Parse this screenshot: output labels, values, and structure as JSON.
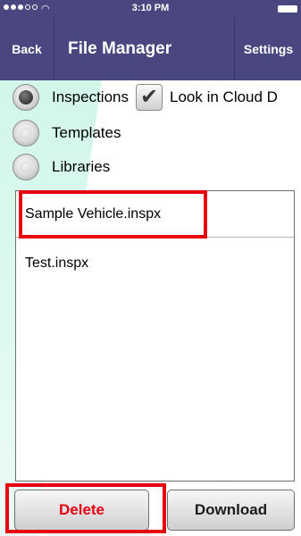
{
  "status_bar": {
    "time": "3:10 PM",
    "signal_icon": "signal-dots-icon",
    "wifi_icon": "wifi-icon",
    "battery_icon": "battery-icon"
  },
  "nav": {
    "back_label": "Back",
    "title": "File Manager",
    "settings_label": "Settings"
  },
  "options": {
    "types": [
      {
        "label": "Inspections",
        "selected": true
      },
      {
        "label": "Templates",
        "selected": false
      },
      {
        "label": "Libraries",
        "selected": false
      }
    ],
    "cloud_checkbox": {
      "label": "Look in Cloud D",
      "checked": true
    }
  },
  "files": [
    {
      "name": "Sample Vehicle.inspx"
    },
    {
      "name": "Test.inspx"
    }
  ],
  "actions": {
    "delete_label": "Delete",
    "download_label": "Download"
  },
  "colors": {
    "nav_bg": "#4a4780",
    "highlight": "#e60012",
    "delete_text": "#e60012"
  }
}
